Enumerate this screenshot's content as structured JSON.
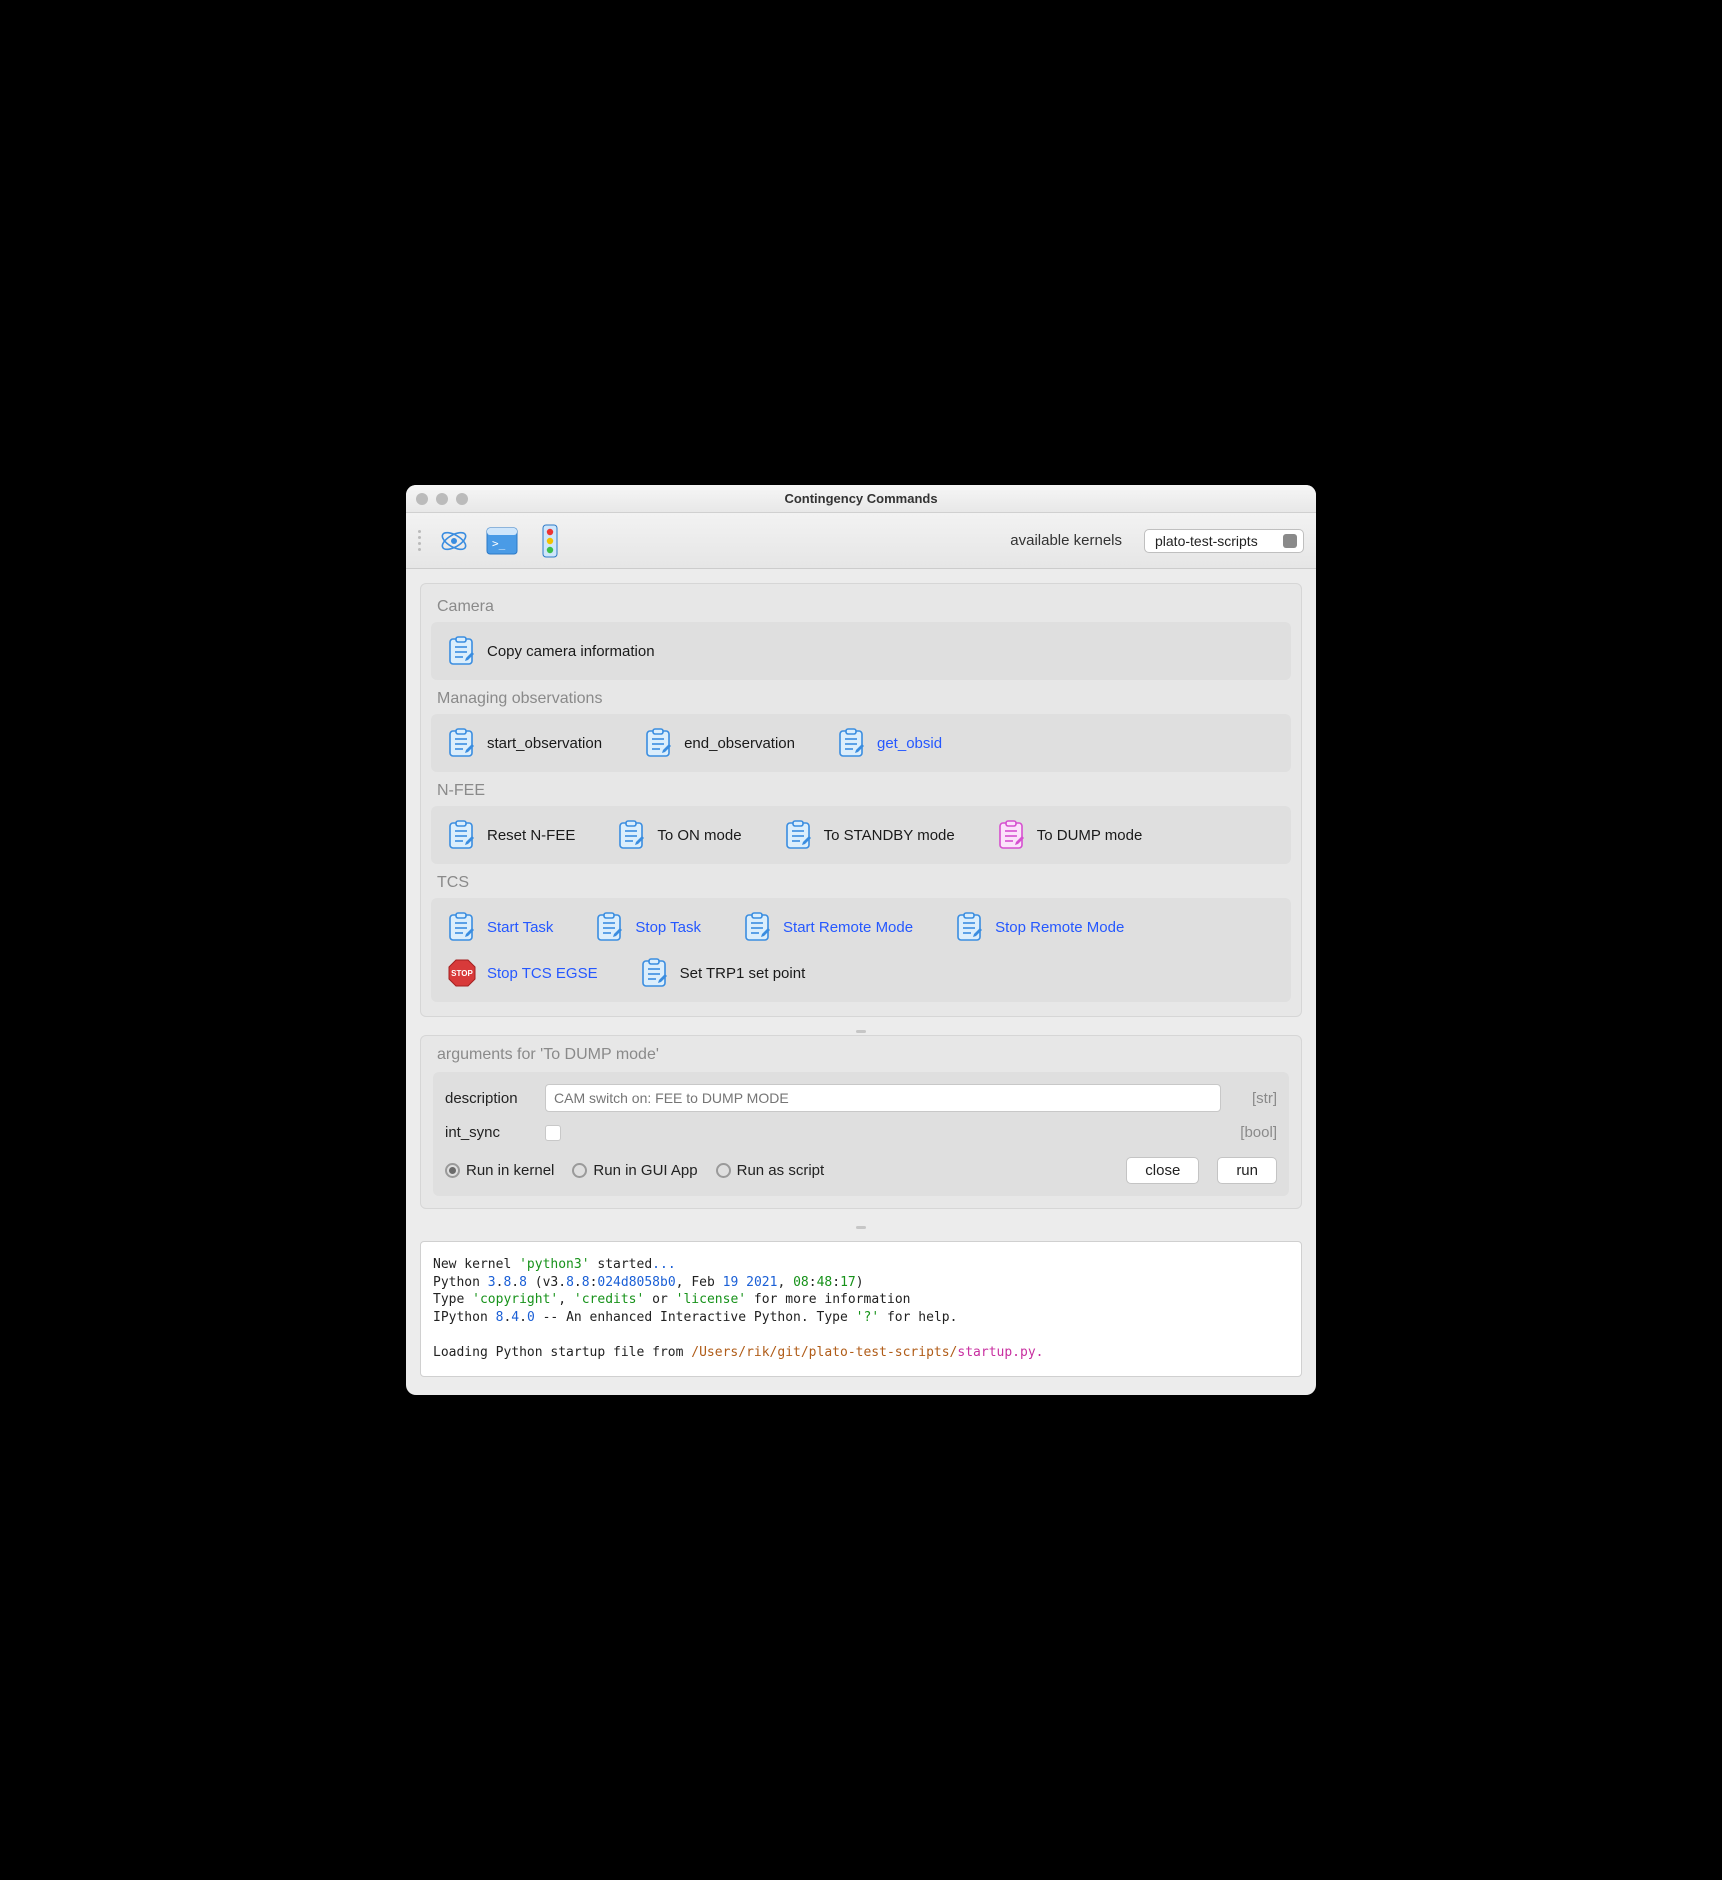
{
  "window": {
    "title": "Contingency Commands"
  },
  "toolbar": {
    "kernel_label": "available kernels",
    "kernel_selected": "plato-test-scripts"
  },
  "sections": [
    {
      "title": "Camera",
      "commands": [
        {
          "label": "Copy camera information",
          "icon": "clipboard-icon",
          "link": false
        }
      ]
    },
    {
      "title": "Managing observations",
      "commands": [
        {
          "label": "start_observation",
          "icon": "clipboard-icon",
          "link": false
        },
        {
          "label": "end_observation",
          "icon": "clipboard-icon",
          "link": false
        },
        {
          "label": "get_obsid",
          "icon": "clipboard-icon",
          "link": true
        }
      ]
    },
    {
      "title": "N-FEE",
      "commands": [
        {
          "label": "Reset N-FEE",
          "icon": "clipboard-icon",
          "link": false
        },
        {
          "label": "To ON mode",
          "icon": "clipboard-icon",
          "link": false
        },
        {
          "label": "To STANDBY mode",
          "icon": "clipboard-icon",
          "link": false
        },
        {
          "label": "To DUMP mode",
          "icon": "clipboard-pink-icon",
          "link": false
        }
      ]
    },
    {
      "title": "TCS",
      "commands": [
        {
          "label": "Start Task",
          "icon": "clipboard-icon",
          "link": true
        },
        {
          "label": "Stop Task",
          "icon": "clipboard-icon",
          "link": true
        },
        {
          "label": "Start Remote Mode",
          "icon": "clipboard-icon",
          "link": true
        },
        {
          "label": "Stop Remote Mode",
          "icon": "clipboard-icon",
          "link": true
        },
        {
          "label": "Stop TCS EGSE",
          "icon": "stop-icon",
          "link": true
        },
        {
          "label": "Set TRP1 set point",
          "icon": "clipboard-icon",
          "link": false
        }
      ]
    }
  ],
  "args": {
    "title": "arguments for 'To DUMP mode'",
    "rows": [
      {
        "name": "description",
        "kind": "text",
        "placeholder": "CAM switch on: FEE to DUMP MODE",
        "type": "[str]"
      },
      {
        "name": "int_sync",
        "kind": "checkbox",
        "type": "[bool]"
      }
    ],
    "radios": [
      {
        "label": "Run in kernel",
        "selected": true
      },
      {
        "label": "Run in GUI App",
        "selected": false
      },
      {
        "label": "Run as script",
        "selected": false
      }
    ],
    "buttons": {
      "close": "close",
      "run": "run"
    }
  },
  "console": {
    "lines": [
      {
        "parts": [
          {
            "t": "New kernel "
          },
          {
            "t": "'python3'",
            "c": "c-g"
          },
          {
            "t": " started"
          },
          {
            "t": "...",
            "c": "c-b"
          }
        ]
      },
      {
        "parts": [
          {
            "t": "Python "
          },
          {
            "t": "3",
            "c": "c-b"
          },
          {
            "t": "."
          },
          {
            "t": "8",
            "c": "c-b"
          },
          {
            "t": "."
          },
          {
            "t": "8",
            "c": "c-b"
          },
          {
            "t": " (v3"
          },
          {
            "t": ".",
            "c": ""
          },
          {
            "t": "8",
            "c": "c-b"
          },
          {
            "t": "."
          },
          {
            "t": "8",
            "c": "c-b"
          },
          {
            "t": ":"
          },
          {
            "t": "024d8058b0",
            "c": "c-b"
          },
          {
            "t": ", Feb "
          },
          {
            "t": "19",
            "c": "c-b"
          },
          {
            "t": " "
          },
          {
            "t": "2021",
            "c": "c-b"
          },
          {
            "t": ", "
          },
          {
            "t": "08",
            "c": "c-g"
          },
          {
            "t": ":"
          },
          {
            "t": "48",
            "c": "c-g"
          },
          {
            "t": ":"
          },
          {
            "t": "17",
            "c": "c-g"
          },
          {
            "t": ")"
          }
        ]
      },
      {
        "parts": [
          {
            "t": "Type "
          },
          {
            "t": "'copyright'",
            "c": "c-g"
          },
          {
            "t": ", "
          },
          {
            "t": "'credits'",
            "c": "c-g"
          },
          {
            "t": " or "
          },
          {
            "t": "'license'",
            "c": "c-g"
          },
          {
            "t": " for more information"
          }
        ]
      },
      {
        "parts": [
          {
            "t": "IPython "
          },
          {
            "t": "8",
            "c": "c-b"
          },
          {
            "t": "."
          },
          {
            "t": "4",
            "c": "c-b"
          },
          {
            "t": "."
          },
          {
            "t": "0",
            "c": "c-b"
          },
          {
            "t": " -- An enhanced Interactive Python. Type "
          },
          {
            "t": "'?'",
            "c": "c-g"
          },
          {
            "t": " for help."
          }
        ]
      },
      {
        "parts": [
          {
            "t": ""
          }
        ]
      },
      {
        "parts": [
          {
            "t": "Loading Python startup file from "
          },
          {
            "t": "/Users/rik/git/plato-test-scripts/",
            "c": "c-o"
          },
          {
            "t": "startup.py.",
            "c": "c-m"
          }
        ]
      }
    ]
  }
}
